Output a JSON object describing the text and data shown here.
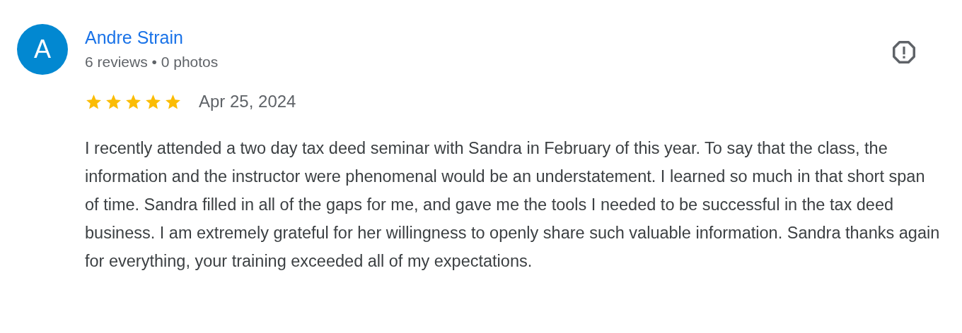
{
  "reviewer": {
    "initial": "A",
    "name": "Andre Strain",
    "meta": "6 reviews • 0 photos"
  },
  "review": {
    "stars": 5,
    "date": "Apr 25, 2024",
    "text": "I recently attended a two day tax deed seminar with Sandra in February of this year. To say that the class, the information and the instructor were phenomenal would be an understatement. I learned so much in that short span of time. Sandra filled in all of the gaps for me, and gave me the tools I needed to be successful in the tax deed business. I am extremely grateful for her willingness to openly share such valuable information. Sandra thanks again for everything, your training exceeded all of my expectations."
  }
}
